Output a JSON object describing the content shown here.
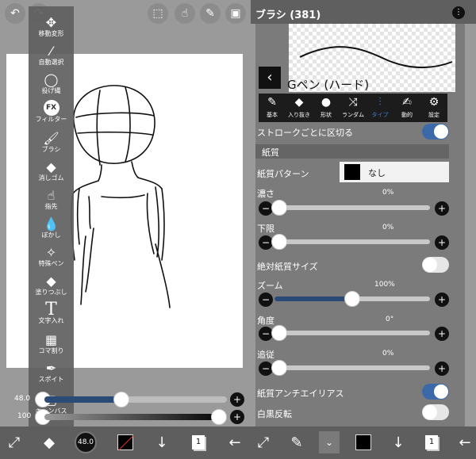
{
  "left": {
    "tools": [
      {
        "label": "移動変形",
        "icon": "move-icon"
      },
      {
        "label": "自動選択",
        "icon": "magic-wand-icon"
      },
      {
        "label": "投げ縄",
        "icon": "lasso-icon"
      },
      {
        "label": "フィルター",
        "icon": "fx-icon",
        "glyph": "FX"
      },
      {
        "label": "ブラシ",
        "icon": "brush-icon"
      },
      {
        "label": "消しゴム",
        "icon": "eraser-icon"
      },
      {
        "label": "指先",
        "icon": "finger-icon"
      },
      {
        "label": "ぼかし",
        "icon": "blur-icon"
      },
      {
        "label": "特殊ペン",
        "icon": "special-pen-icon"
      },
      {
        "label": "塗りつぶし",
        "icon": "fill-icon"
      },
      {
        "label": "文字入れ",
        "icon": "text-icon",
        "glyph": "T"
      },
      {
        "label": "コマ割り",
        "icon": "frame-divider-icon"
      },
      {
        "label": "スポイト",
        "icon": "eyedropper-icon"
      },
      {
        "label": "キャンバス",
        "icon": "canvas-icon"
      }
    ],
    "size_value": "48.0",
    "opacity_value": "100",
    "brush_size_badge": "48.0",
    "layer_badge": "1"
  },
  "right": {
    "title": "ブラシ (381)",
    "brush_name": "Gペン (ハード)",
    "tabs": [
      {
        "label": "基本",
        "icon": "pen-icon",
        "active": false
      },
      {
        "label": "入り抜き",
        "icon": "taper-icon",
        "active": false
      },
      {
        "label": "形状",
        "icon": "shape-icon",
        "active": false
      },
      {
        "label": "ランダム",
        "icon": "shuffle-icon",
        "active": false
      },
      {
        "label": "タイプ",
        "icon": "type-icon",
        "active": true
      },
      {
        "label": "動的",
        "icon": "dynamic-icon",
        "active": false
      },
      {
        "label": "設定",
        "icon": "gear-icon",
        "active": false
      }
    ],
    "stroke_cut_label": "ストロークごとに区切る",
    "section_paper": "紙質",
    "paper_pattern_label": "紙質パターン",
    "paper_pattern_value": "なし",
    "density_label": "濃さ",
    "density_value": "0%",
    "lower_label": "下限",
    "lower_value": "0%",
    "absolute_size_label": "絶対紙質サイズ",
    "zoom_label": "ズーム",
    "zoom_value": "100%",
    "angle_label": "角度",
    "angle_value": "0°",
    "follow_label": "追従",
    "follow_value": "0%",
    "antialias_label": "紙質アンチエイリアス",
    "invert_label": "白黒反転",
    "layer_badge": "1"
  },
  "levels": {
    "size_slider": 0.42,
    "opacity_slider": 1.0,
    "zoom_slider": 0.5,
    "density": 0.0,
    "lower": 0.0,
    "angle": 0.0,
    "follow": 0.0
  },
  "toggles": {
    "stroke_cut": true,
    "absolute_size": false,
    "antialias": true,
    "invert": false
  },
  "colors": {
    "accent": "#3a6fc4",
    "toggle_on": "#3c6aa8",
    "panel": "#7b7b7b"
  }
}
